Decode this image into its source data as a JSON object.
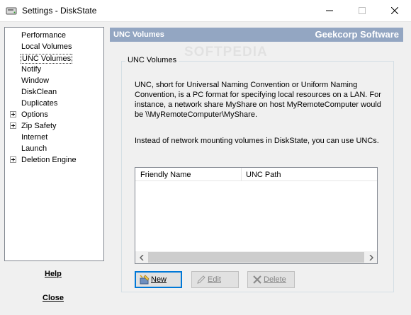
{
  "window": {
    "title": "Settings - DiskState"
  },
  "tree": {
    "items": [
      {
        "label": "Performance",
        "expandable": false
      },
      {
        "label": "Local Volumes",
        "expandable": false
      },
      {
        "label": "UNC Volumes",
        "expandable": false,
        "selected": true
      },
      {
        "label": "Notify",
        "expandable": false
      },
      {
        "label": "Window",
        "expandable": false
      },
      {
        "label": "DiskClean",
        "expandable": false
      },
      {
        "label": "Duplicates",
        "expandable": false
      },
      {
        "label": "Options",
        "expandable": true
      },
      {
        "label": "Zip Safety",
        "expandable": true
      },
      {
        "label": "Internet",
        "expandable": false
      },
      {
        "label": "Launch",
        "expandable": false
      },
      {
        "label": "Deletion Engine",
        "expandable": true
      }
    ]
  },
  "side": {
    "help_label": "Help",
    "close_label": "Close"
  },
  "header": {
    "section": "UNC Volumes",
    "brand": "Geekcorp Software",
    "watermark": "SOFTPEDIA"
  },
  "group": {
    "label": "UNC Volumes",
    "paragraph1": "UNC, short for Universal Naming Convention or Uniform Naming Convention, is a PC format for specifying local resources on a LAN. For instance, a network share MyShare on host MyRemoteComputer would be \\\\MyRemoteComputer\\MyShare.",
    "paragraph2": "Instead of network mounting volumes in DiskState, you can use UNCs."
  },
  "list": {
    "columns": [
      "Friendly Name",
      "UNC Path"
    ],
    "rows": []
  },
  "buttons": {
    "new": "New",
    "edit": "Edit",
    "delete": "Delete"
  },
  "colors": {
    "header_band": "#93a6c2",
    "focus_border": "#0078d7"
  }
}
